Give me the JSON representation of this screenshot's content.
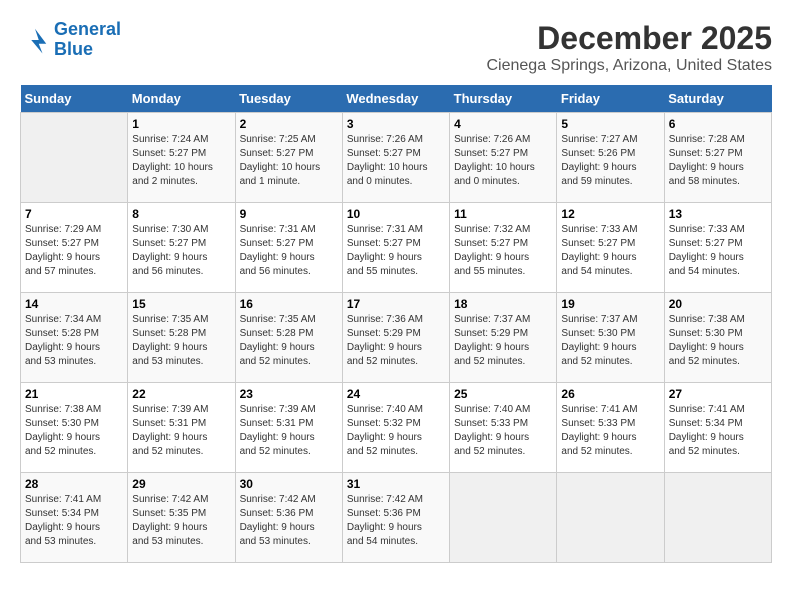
{
  "header": {
    "logo_line1": "General",
    "logo_line2": "Blue",
    "month": "December 2025",
    "location": "Cienega Springs, Arizona, United States"
  },
  "weekdays": [
    "Sunday",
    "Monday",
    "Tuesday",
    "Wednesday",
    "Thursday",
    "Friday",
    "Saturday"
  ],
  "weeks": [
    [
      {
        "day": "",
        "info": ""
      },
      {
        "day": "1",
        "info": "Sunrise: 7:24 AM\nSunset: 5:27 PM\nDaylight: 10 hours\nand 2 minutes."
      },
      {
        "day": "2",
        "info": "Sunrise: 7:25 AM\nSunset: 5:27 PM\nDaylight: 10 hours\nand 1 minute."
      },
      {
        "day": "3",
        "info": "Sunrise: 7:26 AM\nSunset: 5:27 PM\nDaylight: 10 hours\nand 0 minutes."
      },
      {
        "day": "4",
        "info": "Sunrise: 7:26 AM\nSunset: 5:27 PM\nDaylight: 10 hours\nand 0 minutes."
      },
      {
        "day": "5",
        "info": "Sunrise: 7:27 AM\nSunset: 5:26 PM\nDaylight: 9 hours\nand 59 minutes."
      },
      {
        "day": "6",
        "info": "Sunrise: 7:28 AM\nSunset: 5:27 PM\nDaylight: 9 hours\nand 58 minutes."
      }
    ],
    [
      {
        "day": "7",
        "info": "Sunrise: 7:29 AM\nSunset: 5:27 PM\nDaylight: 9 hours\nand 57 minutes."
      },
      {
        "day": "8",
        "info": "Sunrise: 7:30 AM\nSunset: 5:27 PM\nDaylight: 9 hours\nand 56 minutes."
      },
      {
        "day": "9",
        "info": "Sunrise: 7:31 AM\nSunset: 5:27 PM\nDaylight: 9 hours\nand 56 minutes."
      },
      {
        "day": "10",
        "info": "Sunrise: 7:31 AM\nSunset: 5:27 PM\nDaylight: 9 hours\nand 55 minutes."
      },
      {
        "day": "11",
        "info": "Sunrise: 7:32 AM\nSunset: 5:27 PM\nDaylight: 9 hours\nand 55 minutes."
      },
      {
        "day": "12",
        "info": "Sunrise: 7:33 AM\nSunset: 5:27 PM\nDaylight: 9 hours\nand 54 minutes."
      },
      {
        "day": "13",
        "info": "Sunrise: 7:33 AM\nSunset: 5:27 PM\nDaylight: 9 hours\nand 54 minutes."
      }
    ],
    [
      {
        "day": "14",
        "info": "Sunrise: 7:34 AM\nSunset: 5:28 PM\nDaylight: 9 hours\nand 53 minutes."
      },
      {
        "day": "15",
        "info": "Sunrise: 7:35 AM\nSunset: 5:28 PM\nDaylight: 9 hours\nand 53 minutes."
      },
      {
        "day": "16",
        "info": "Sunrise: 7:35 AM\nSunset: 5:28 PM\nDaylight: 9 hours\nand 52 minutes."
      },
      {
        "day": "17",
        "info": "Sunrise: 7:36 AM\nSunset: 5:29 PM\nDaylight: 9 hours\nand 52 minutes."
      },
      {
        "day": "18",
        "info": "Sunrise: 7:37 AM\nSunset: 5:29 PM\nDaylight: 9 hours\nand 52 minutes."
      },
      {
        "day": "19",
        "info": "Sunrise: 7:37 AM\nSunset: 5:30 PM\nDaylight: 9 hours\nand 52 minutes."
      },
      {
        "day": "20",
        "info": "Sunrise: 7:38 AM\nSunset: 5:30 PM\nDaylight: 9 hours\nand 52 minutes."
      }
    ],
    [
      {
        "day": "21",
        "info": "Sunrise: 7:38 AM\nSunset: 5:30 PM\nDaylight: 9 hours\nand 52 minutes."
      },
      {
        "day": "22",
        "info": "Sunrise: 7:39 AM\nSunset: 5:31 PM\nDaylight: 9 hours\nand 52 minutes."
      },
      {
        "day": "23",
        "info": "Sunrise: 7:39 AM\nSunset: 5:31 PM\nDaylight: 9 hours\nand 52 minutes."
      },
      {
        "day": "24",
        "info": "Sunrise: 7:40 AM\nSunset: 5:32 PM\nDaylight: 9 hours\nand 52 minutes."
      },
      {
        "day": "25",
        "info": "Sunrise: 7:40 AM\nSunset: 5:33 PM\nDaylight: 9 hours\nand 52 minutes."
      },
      {
        "day": "26",
        "info": "Sunrise: 7:41 AM\nSunset: 5:33 PM\nDaylight: 9 hours\nand 52 minutes."
      },
      {
        "day": "27",
        "info": "Sunrise: 7:41 AM\nSunset: 5:34 PM\nDaylight: 9 hours\nand 52 minutes."
      }
    ],
    [
      {
        "day": "28",
        "info": "Sunrise: 7:41 AM\nSunset: 5:34 PM\nDaylight: 9 hours\nand 53 minutes."
      },
      {
        "day": "29",
        "info": "Sunrise: 7:42 AM\nSunset: 5:35 PM\nDaylight: 9 hours\nand 53 minutes."
      },
      {
        "day": "30",
        "info": "Sunrise: 7:42 AM\nSunset: 5:36 PM\nDaylight: 9 hours\nand 53 minutes."
      },
      {
        "day": "31",
        "info": "Sunrise: 7:42 AM\nSunset: 5:36 PM\nDaylight: 9 hours\nand 54 minutes."
      },
      {
        "day": "",
        "info": ""
      },
      {
        "day": "",
        "info": ""
      },
      {
        "day": "",
        "info": ""
      }
    ]
  ]
}
